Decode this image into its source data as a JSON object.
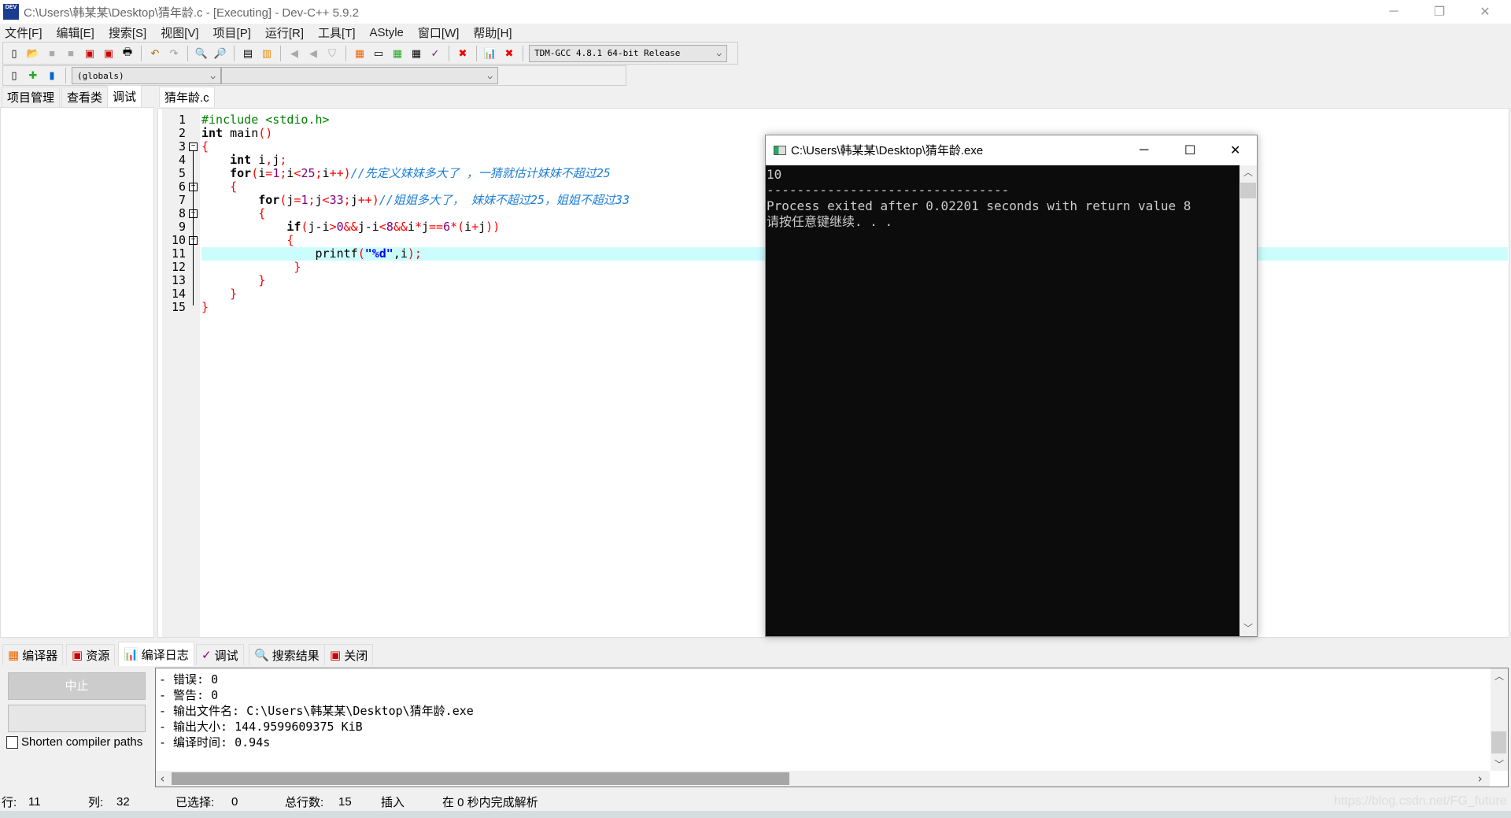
{
  "window": {
    "title": "C:\\Users\\韩某某\\Desktop\\猜年龄.c - [Executing] - Dev-C++ 5.9.2",
    "app_icon_text": "DEV"
  },
  "menu": [
    "文件[F]",
    "编辑[E]",
    "搜索[S]",
    "视图[V]",
    "项目[P]",
    "运行[R]",
    "工具[T]",
    "AStyle",
    "窗口[W]",
    "帮助[H]"
  ],
  "toolbar": {
    "compiler": "TDM-GCC 4.8.1 64-bit Release",
    "scope": "(globals)",
    "symbol": ""
  },
  "left_tabs": [
    "项目管理",
    "查看类",
    "调试"
  ],
  "editor_tab": "猜年龄.c",
  "code": [
    [
      {
        "t": "#include <stdio.h>",
        "c": "pp"
      }
    ],
    [
      {
        "t": "int",
        "c": "kw"
      },
      {
        "t": " main"
      },
      {
        "t": "()",
        "c": "sym"
      }
    ],
    [
      {
        "t": "{",
        "c": "sym"
      }
    ],
    [
      {
        "t": "    "
      },
      {
        "t": "int",
        "c": "kw"
      },
      {
        "t": " i"
      },
      {
        "t": ",",
        "c": "sym"
      },
      {
        "t": "j"
      },
      {
        "t": ";",
        "c": "sym"
      }
    ],
    [
      {
        "t": "    "
      },
      {
        "t": "for",
        "c": "kw"
      },
      {
        "t": "(",
        "c": "sym"
      },
      {
        "t": "i"
      },
      {
        "t": "=",
        "c": "sym"
      },
      {
        "t": "1",
        "c": "num"
      },
      {
        "t": ";",
        "c": "sym"
      },
      {
        "t": "i"
      },
      {
        "t": "<",
        "c": "sym"
      },
      {
        "t": "25",
        "c": "num"
      },
      {
        "t": ";",
        "c": "sym"
      },
      {
        "t": "i"
      },
      {
        "t": "++)",
        "c": "sym"
      },
      {
        "t": "//先定义妹妹多大了 ，一猜就估计妹妹不超过25",
        "c": "cm"
      }
    ],
    [
      {
        "t": "    "
      },
      {
        "t": "{",
        "c": "sym"
      }
    ],
    [
      {
        "t": "        "
      },
      {
        "t": "for",
        "c": "kw"
      },
      {
        "t": "(",
        "c": "sym"
      },
      {
        "t": "j"
      },
      {
        "t": "=",
        "c": "sym"
      },
      {
        "t": "1",
        "c": "num"
      },
      {
        "t": ";",
        "c": "sym"
      },
      {
        "t": "j"
      },
      {
        "t": "<",
        "c": "sym"
      },
      {
        "t": "33",
        "c": "num"
      },
      {
        "t": ";",
        "c": "sym"
      },
      {
        "t": "j"
      },
      {
        "t": "++)",
        "c": "sym"
      },
      {
        "t": "//姐姐多大了， 妹妹不超过25，姐姐不超过33",
        "c": "cm"
      }
    ],
    [
      {
        "t": "        "
      },
      {
        "t": "{",
        "c": "sym"
      }
    ],
    [
      {
        "t": "            "
      },
      {
        "t": "if",
        "c": "kw"
      },
      {
        "t": "(",
        "c": "sym"
      },
      {
        "t": "j-i"
      },
      {
        "t": ">",
        "c": "sym"
      },
      {
        "t": "0",
        "c": "num"
      },
      {
        "t": "&&",
        "c": "sym"
      },
      {
        "t": "j-i"
      },
      {
        "t": "<",
        "c": "sym"
      },
      {
        "t": "8",
        "c": "num"
      },
      {
        "t": "&&",
        "c": "sym"
      },
      {
        "t": "i"
      },
      {
        "t": "*",
        "c": "sym"
      },
      {
        "t": "j"
      },
      {
        "t": "==",
        "c": "sym"
      },
      {
        "t": "6",
        "c": "num"
      },
      {
        "t": "*(",
        "c": "sym"
      },
      {
        "t": "i"
      },
      {
        "t": "+",
        "c": "sym"
      },
      {
        "t": "j"
      },
      {
        "t": "))",
        "c": "sym"
      }
    ],
    [
      {
        "t": "            "
      },
      {
        "t": "{",
        "c": "sym"
      }
    ],
    [
      {
        "t": "                "
      },
      {
        "t": "printf"
      },
      {
        "t": "(",
        "c": "sym"
      },
      {
        "t": "\"%d\"",
        "c": "str"
      },
      {
        "t": ","
      },
      {
        "t": "i"
      },
      {
        "t": ");",
        "c": "sym"
      }
    ],
    [
      {
        "t": "             "
      },
      {
        "t": "}",
        "c": "sym"
      }
    ],
    [
      {
        "t": "        "
      },
      {
        "t": "}",
        "c": "sym"
      }
    ],
    [
      {
        "t": "    "
      },
      {
        "t": "}",
        "c": "sym"
      }
    ],
    [
      {
        "t": "}",
        "c": "sym"
      }
    ]
  ],
  "highlight_line": 11,
  "console": {
    "title": "C:\\Users\\韩某某\\Desktop\\猜年龄.exe",
    "output": "10\n--------------------------------\nProcess exited after 0.02201 seconds with return value 8\n请按任意键继续. . ."
  },
  "bottom_tabs": [
    "编译器",
    "资源",
    "编译日志",
    "调试",
    "搜索结果",
    "关闭"
  ],
  "bottom": {
    "abort_label": "中止",
    "shorten_label": "Shorten compiler paths",
    "shorten_checked": false,
    "log": [
      "- 错误: 0",
      "- 警告: 0",
      "- 输出文件名: C:\\Users\\韩某某\\Desktop\\猜年龄.exe",
      "- 输出大小: 144.9599609375 KiB",
      "- 编译时间: 0.94s"
    ]
  },
  "status": {
    "row_label": "行:",
    "row": "11",
    "col_label": "列:",
    "col": "32",
    "sel_label": "已选择:",
    "sel": "0",
    "total_label": "总行数:",
    "total": "15",
    "mode": "插入",
    "parse": "在 0 秒内完成解析"
  },
  "watermark": "https://blog.csdn.net/FG_future"
}
